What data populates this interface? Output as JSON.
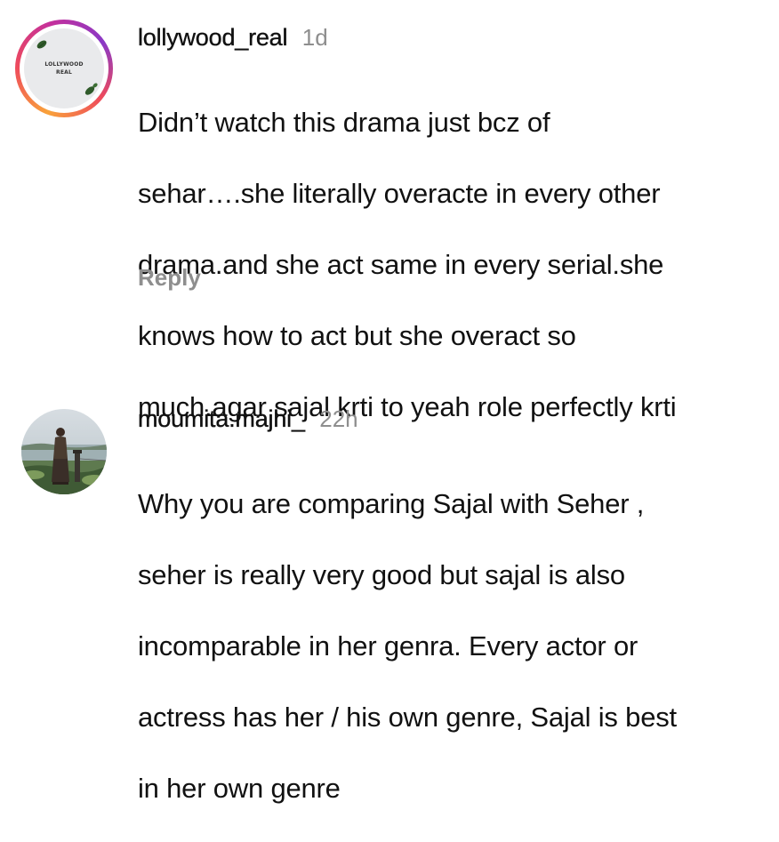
{
  "comments": [
    {
      "username": "lollywood_real",
      "time": "1d",
      "avatar_text": [
        "LOLLYWOOD",
        "REAL"
      ],
      "lines": [
        "Didn’t watch this drama just bcz of",
        "sehar….she literally overacte in every other",
        "drama.and she act same in every serial.she",
        "knows how to act but she overact so",
        "much.agar sajal krti to yeah role perfectly krti"
      ],
      "reply_label": "Reply"
    },
    {
      "username": "moumita.majhi_",
      "time": "22h",
      "lines": [
        "Why you are comparing Sajal with Seher ,",
        "seher is really very good but sajal is also",
        "incomparable in her genra. Every actor or",
        "actress has her / his own genre, Sajal is best",
        "in her own genre"
      ]
    }
  ],
  "colors": {
    "text": "#111111",
    "muted": "#8e8e8e",
    "ring_start": "#f9a23a",
    "ring_end": "#c4309c"
  }
}
